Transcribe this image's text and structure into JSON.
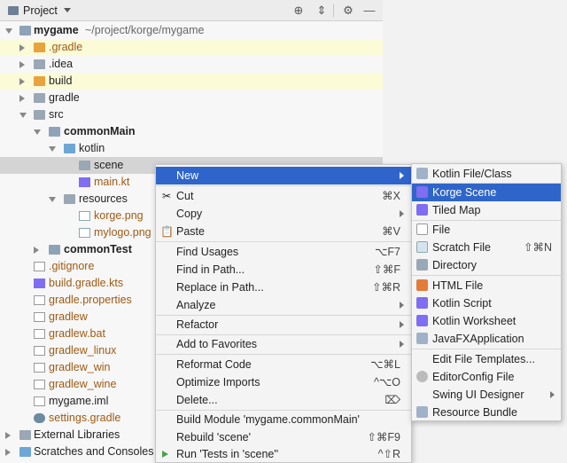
{
  "panel": {
    "title": "Project",
    "header_icons": [
      "crosshair-icon",
      "collapse-icon",
      "gear-icon",
      "minimize-icon"
    ]
  },
  "tree": [
    {
      "label": "mygame",
      "path": "~/project/korge/mygame"
    },
    {
      "label": ".gradle"
    },
    {
      "label": ".idea"
    },
    {
      "label": "build"
    },
    {
      "label": "gradle"
    },
    {
      "label": "src"
    },
    {
      "label": "commonMain"
    },
    {
      "label": "kotlin"
    },
    {
      "label": "scene"
    },
    {
      "label": "main.kt"
    },
    {
      "label": "resources"
    },
    {
      "label": "korge.png"
    },
    {
      "label": "mylogo.png"
    },
    {
      "label": "commonTest"
    },
    {
      "label": ".gitignore"
    },
    {
      "label": "build.gradle.kts"
    },
    {
      "label": "gradle.properties"
    },
    {
      "label": "gradlew"
    },
    {
      "label": "gradlew.bat"
    },
    {
      "label": "gradlew_linux"
    },
    {
      "label": "gradlew_win"
    },
    {
      "label": "gradlew_wine"
    },
    {
      "label": "mygame.iml"
    },
    {
      "label": "settings.gradle"
    },
    {
      "label": "External Libraries"
    },
    {
      "label": "Scratches and Consoles"
    }
  ],
  "context_menu": [
    {
      "label": "New",
      "shortcut": ""
    },
    {
      "label": "Cut",
      "shortcut": "⌘X",
      "icon": "✂"
    },
    {
      "label": "Copy",
      "shortcut": ""
    },
    {
      "label": "Paste",
      "shortcut": "⌘V",
      "icon": "📋"
    },
    {
      "label": "Find Usages",
      "shortcut": "⌥F7"
    },
    {
      "label": "Find in Path...",
      "shortcut": "⇧⌘F"
    },
    {
      "label": "Replace in Path...",
      "shortcut": "⇧⌘R"
    },
    {
      "label": "Analyze",
      "shortcut": ""
    },
    {
      "label": "Refactor",
      "shortcut": ""
    },
    {
      "label": "Add to Favorites",
      "shortcut": ""
    },
    {
      "label": "Reformat Code",
      "shortcut": "⌥⌘L"
    },
    {
      "label": "Optimize Imports",
      "shortcut": "^⌥O"
    },
    {
      "label": "Delete...",
      "shortcut": "⌦"
    },
    {
      "label": "Build Module 'mygame.commonMain'",
      "shortcut": ""
    },
    {
      "label": "Rebuild 'scene'",
      "shortcut": "⇧⌘F9"
    },
    {
      "label": "Run 'Tests in 'scene''",
      "shortcut": "^⇧R"
    }
  ],
  "submenu": [
    {
      "label": "Kotlin File/Class",
      "shortcut": ""
    },
    {
      "label": "Korge Scene",
      "shortcut": ""
    },
    {
      "label": "Tiled Map",
      "shortcut": ""
    },
    {
      "label": "File",
      "shortcut": ""
    },
    {
      "label": "Scratch File",
      "shortcut": "⇧⌘N"
    },
    {
      "label": "Directory",
      "shortcut": ""
    },
    {
      "label": "HTML File",
      "shortcut": ""
    },
    {
      "label": "Kotlin Script",
      "shortcut": ""
    },
    {
      "label": "Kotlin Worksheet",
      "shortcut": ""
    },
    {
      "label": "JavaFXApplication",
      "shortcut": ""
    },
    {
      "label": "Edit File Templates...",
      "shortcut": ""
    },
    {
      "label": "EditorConfig File",
      "shortcut": ""
    },
    {
      "label": "Swing UI Designer",
      "shortcut": ""
    },
    {
      "label": "Resource Bundle",
      "shortcut": ""
    }
  ],
  "colors": {
    "selection": "#2f65ca",
    "folder_orange": "#e8a33c",
    "folder_blue": "#6ea6d6",
    "modified_text": "#a05a12"
  }
}
